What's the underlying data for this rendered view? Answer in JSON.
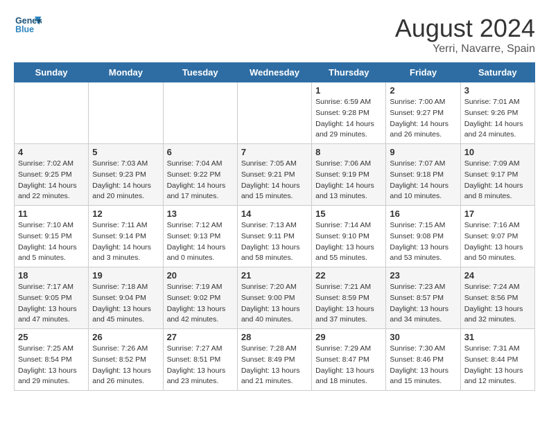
{
  "header": {
    "logo_line1": "General",
    "logo_line2": "Blue",
    "month_year": "August 2024",
    "location": "Yerri, Navarre, Spain"
  },
  "days_of_week": [
    "Sunday",
    "Monday",
    "Tuesday",
    "Wednesday",
    "Thursday",
    "Friday",
    "Saturday"
  ],
  "weeks": [
    [
      {
        "day": "",
        "info": ""
      },
      {
        "day": "",
        "info": ""
      },
      {
        "day": "",
        "info": ""
      },
      {
        "day": "",
        "info": ""
      },
      {
        "day": "1",
        "info": "Sunrise: 6:59 AM\nSunset: 9:28 PM\nDaylight: 14 hours\nand 29 minutes."
      },
      {
        "day": "2",
        "info": "Sunrise: 7:00 AM\nSunset: 9:27 PM\nDaylight: 14 hours\nand 26 minutes."
      },
      {
        "day": "3",
        "info": "Sunrise: 7:01 AM\nSunset: 9:26 PM\nDaylight: 14 hours\nand 24 minutes."
      }
    ],
    [
      {
        "day": "4",
        "info": "Sunrise: 7:02 AM\nSunset: 9:25 PM\nDaylight: 14 hours\nand 22 minutes."
      },
      {
        "day": "5",
        "info": "Sunrise: 7:03 AM\nSunset: 9:23 PM\nDaylight: 14 hours\nand 20 minutes."
      },
      {
        "day": "6",
        "info": "Sunrise: 7:04 AM\nSunset: 9:22 PM\nDaylight: 14 hours\nand 17 minutes."
      },
      {
        "day": "7",
        "info": "Sunrise: 7:05 AM\nSunset: 9:21 PM\nDaylight: 14 hours\nand 15 minutes."
      },
      {
        "day": "8",
        "info": "Sunrise: 7:06 AM\nSunset: 9:19 PM\nDaylight: 14 hours\nand 13 minutes."
      },
      {
        "day": "9",
        "info": "Sunrise: 7:07 AM\nSunset: 9:18 PM\nDaylight: 14 hours\nand 10 minutes."
      },
      {
        "day": "10",
        "info": "Sunrise: 7:09 AM\nSunset: 9:17 PM\nDaylight: 14 hours\nand 8 minutes."
      }
    ],
    [
      {
        "day": "11",
        "info": "Sunrise: 7:10 AM\nSunset: 9:15 PM\nDaylight: 14 hours\nand 5 minutes."
      },
      {
        "day": "12",
        "info": "Sunrise: 7:11 AM\nSunset: 9:14 PM\nDaylight: 14 hours\nand 3 minutes."
      },
      {
        "day": "13",
        "info": "Sunrise: 7:12 AM\nSunset: 9:13 PM\nDaylight: 14 hours\nand 0 minutes."
      },
      {
        "day": "14",
        "info": "Sunrise: 7:13 AM\nSunset: 9:11 PM\nDaylight: 13 hours\nand 58 minutes."
      },
      {
        "day": "15",
        "info": "Sunrise: 7:14 AM\nSunset: 9:10 PM\nDaylight: 13 hours\nand 55 minutes."
      },
      {
        "day": "16",
        "info": "Sunrise: 7:15 AM\nSunset: 9:08 PM\nDaylight: 13 hours\nand 53 minutes."
      },
      {
        "day": "17",
        "info": "Sunrise: 7:16 AM\nSunset: 9:07 PM\nDaylight: 13 hours\nand 50 minutes."
      }
    ],
    [
      {
        "day": "18",
        "info": "Sunrise: 7:17 AM\nSunset: 9:05 PM\nDaylight: 13 hours\nand 47 minutes."
      },
      {
        "day": "19",
        "info": "Sunrise: 7:18 AM\nSunset: 9:04 PM\nDaylight: 13 hours\nand 45 minutes."
      },
      {
        "day": "20",
        "info": "Sunrise: 7:19 AM\nSunset: 9:02 PM\nDaylight: 13 hours\nand 42 minutes."
      },
      {
        "day": "21",
        "info": "Sunrise: 7:20 AM\nSunset: 9:00 PM\nDaylight: 13 hours\nand 40 minutes."
      },
      {
        "day": "22",
        "info": "Sunrise: 7:21 AM\nSunset: 8:59 PM\nDaylight: 13 hours\nand 37 minutes."
      },
      {
        "day": "23",
        "info": "Sunrise: 7:23 AM\nSunset: 8:57 PM\nDaylight: 13 hours\nand 34 minutes."
      },
      {
        "day": "24",
        "info": "Sunrise: 7:24 AM\nSunset: 8:56 PM\nDaylight: 13 hours\nand 32 minutes."
      }
    ],
    [
      {
        "day": "25",
        "info": "Sunrise: 7:25 AM\nSunset: 8:54 PM\nDaylight: 13 hours\nand 29 minutes."
      },
      {
        "day": "26",
        "info": "Sunrise: 7:26 AM\nSunset: 8:52 PM\nDaylight: 13 hours\nand 26 minutes."
      },
      {
        "day": "27",
        "info": "Sunrise: 7:27 AM\nSunset: 8:51 PM\nDaylight: 13 hours\nand 23 minutes."
      },
      {
        "day": "28",
        "info": "Sunrise: 7:28 AM\nSunset: 8:49 PM\nDaylight: 13 hours\nand 21 minutes."
      },
      {
        "day": "29",
        "info": "Sunrise: 7:29 AM\nSunset: 8:47 PM\nDaylight: 13 hours\nand 18 minutes."
      },
      {
        "day": "30",
        "info": "Sunrise: 7:30 AM\nSunset: 8:46 PM\nDaylight: 13 hours\nand 15 minutes."
      },
      {
        "day": "31",
        "info": "Sunrise: 7:31 AM\nSunset: 8:44 PM\nDaylight: 13 hours\nand 12 minutes."
      }
    ]
  ]
}
